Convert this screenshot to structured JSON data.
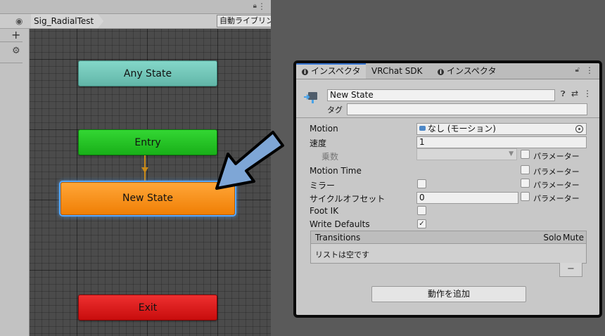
{
  "animator": {
    "breadcrumb": "Sig_RadialTest",
    "auto_live_link": "自動ライブリンク",
    "add_symbol": "+",
    "states": {
      "any_state": "Any State",
      "entry": "Entry",
      "new_state": "New State",
      "exit": "Exit"
    },
    "colors": {
      "any_state": "#72c7b9",
      "entry": "#22c422",
      "new_state": "#f7930f",
      "exit": "#e01e1e",
      "selection": "#56a8ff",
      "transition": "#c98a18"
    }
  },
  "annotation": {
    "arrow_color": "#7ea6d6"
  },
  "inspector": {
    "tabs": [
      {
        "label": "インスペクター",
        "icon": "info-icon",
        "active": true
      },
      {
        "label": "VRChat SDK",
        "icon": "",
        "active": false
      },
      {
        "label": "インスペクター",
        "icon": "info-icon",
        "active": false
      }
    ],
    "state_name": "New State",
    "tag_label": "タグ",
    "tag_value": "",
    "fields": {
      "motion_label": "Motion",
      "motion_value": "なし (モーション)",
      "speed_label": "速度",
      "speed_value": "1",
      "multiplier_label": "乗数",
      "multiplier_value": "",
      "motion_time_label": "Motion Time",
      "mirror_label": "ミラー",
      "cycle_offset_label": "サイクルオフセット",
      "cycle_offset_value": "0",
      "foot_ik_label": "Foot IK",
      "write_defaults_label": "Write Defaults",
      "write_defaults_checked": true,
      "parameter_label": "パラメーター"
    },
    "transitions": {
      "title": "Transitions",
      "solo": "Solo",
      "mute": "Mute",
      "empty": "リストは空です",
      "remove": "−"
    },
    "add_behaviour": "動作を追加"
  }
}
